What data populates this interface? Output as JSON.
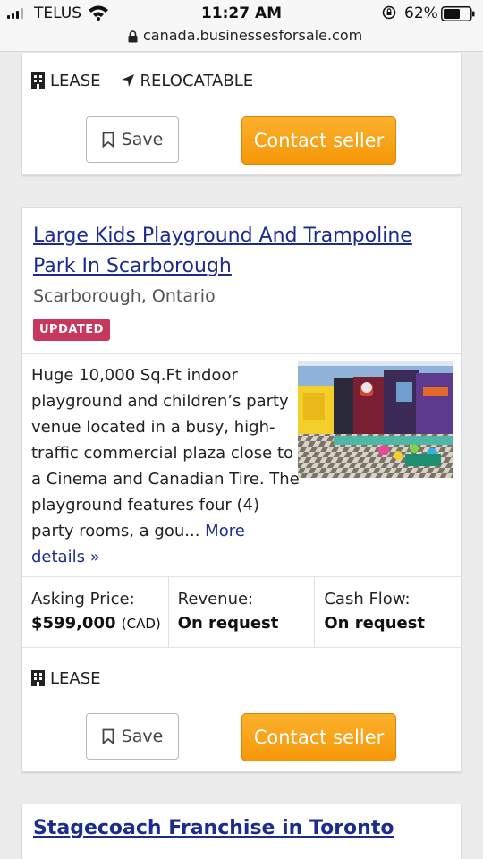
{
  "status_bar": {
    "carrier": "TELUS",
    "time": "11:27 AM",
    "battery": "62%",
    "battery_level": 0.62
  },
  "browser": {
    "url": "canada.businessesforsale.com"
  },
  "top_card": {
    "tags": [
      "LEASE",
      "RELOCATABLE"
    ],
    "save_label": "Save",
    "contact_label": "Contact seller"
  },
  "listing": {
    "title": "Large Kids Playground And Trampoline Park In Scarborough",
    "location": "Scarborough, Ontario",
    "badge": "UPDATED",
    "description": "Huge 10,000 Sq.Ft indoor playground and children’s party venue located in a busy, high-traffic commercial plaza close to a Cinema and Canadian Tire. The playground features four (4) party rooms, a gou...",
    "more_link": "More details »",
    "stats": [
      {
        "label": "Asking Price:",
        "value": "$599,000",
        "unit": "(CAD)"
      },
      {
        "label": "Revenue:",
        "value": "On request",
        "unit": ""
      },
      {
        "label": "Cash Flow:",
        "value": "On request",
        "unit": ""
      }
    ],
    "tags": [
      "LEASE"
    ],
    "save_label": "Save",
    "contact_label": "Contact seller"
  },
  "next_listing": {
    "title": "Stagecoach Franchise in Toronto"
  },
  "colors": {
    "link": "#1c2c8c",
    "accent_orange": "#f7a11a",
    "badge": "#c8375c"
  },
  "icons": [
    "wifi-icon",
    "rotation-lock-icon",
    "battery-icon",
    "lock-icon",
    "building-icon",
    "location-arrow-icon",
    "bookmark-icon"
  ]
}
